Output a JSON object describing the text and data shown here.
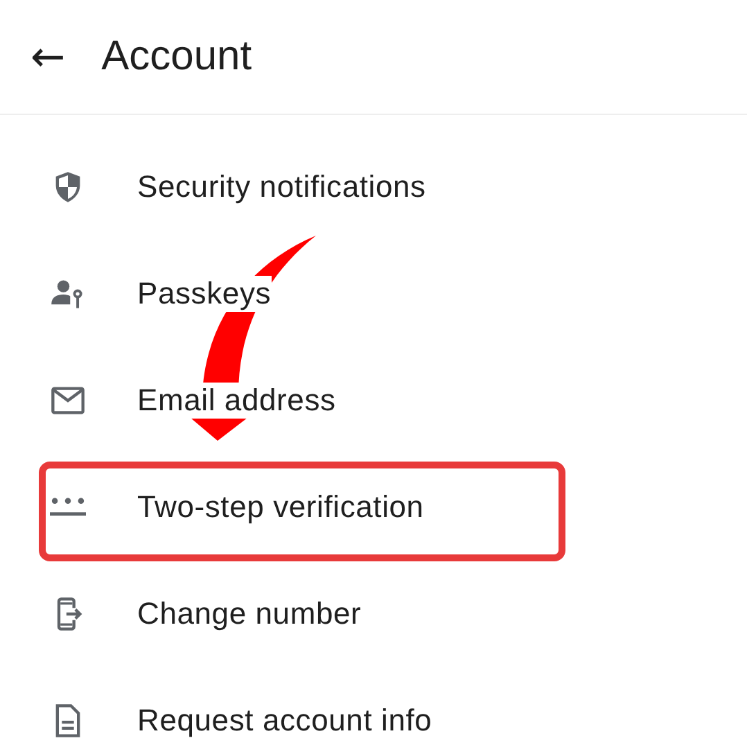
{
  "header": {
    "back": "←",
    "title": "Account"
  },
  "items": [
    {
      "kind": "shield",
      "label": "Security notifications",
      "highlighted": false
    },
    {
      "kind": "passkey",
      "label": "Passkeys",
      "highlighted": false
    },
    {
      "kind": "email",
      "label": "Email address",
      "highlighted": false
    },
    {
      "kind": "password",
      "label": "Two-step verification",
      "highlighted": true
    },
    {
      "kind": "phone",
      "label": "Change number",
      "highlighted": false
    },
    {
      "kind": "document",
      "label": "Request account info",
      "highlighted": false
    }
  ]
}
